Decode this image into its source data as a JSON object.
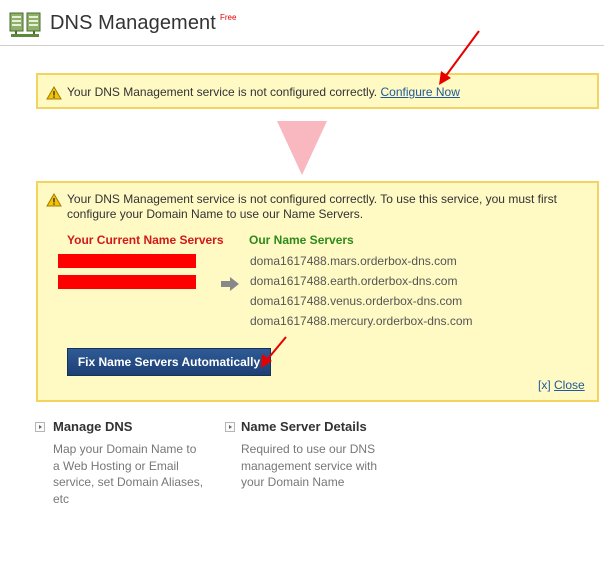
{
  "header": {
    "title": "DNS Management",
    "badge": "Free"
  },
  "alert_short": {
    "message": "Your DNS Management service is not configured correctly.",
    "link_label": "Configure Now"
  },
  "alert_full": {
    "message": "Your DNS Management service is not configured correctly. To use this service, you must first configure your Domain Name to use our Name Servers.",
    "current_heading": "Your Current Name Servers",
    "our_heading": "Our Name Servers",
    "name_servers": [
      "doma1617488.mars.orderbox-dns.com",
      "doma1617488.earth.orderbox-dns.com",
      "doma1617488.venus.orderbox-dns.com",
      "doma1617488.mercury.orderbox-dns.com"
    ],
    "fix_button": "Fix Name Servers Automatically",
    "close_prefix": "[x]",
    "close_label": "Close"
  },
  "sections": [
    {
      "title": "Manage DNS",
      "description": "Map your Domain Name to a Web Hosting or Email service, set Domain Aliases, etc"
    },
    {
      "title": "Name Server Details",
      "description": "Required to use our DNS management service with your Domain Name"
    }
  ],
  "colors": {
    "alert_bg": "#fff9c4",
    "alert_border": "#f2d45e",
    "current_heading": "#d11a1a",
    "our_heading": "#2e8b1a",
    "button": "#1d3f75",
    "link": "#1f5a9a",
    "annotation_arrow": "#e60000",
    "flow_triangle": "#f9b7bf"
  },
  "icons": [
    "dns-server-icon",
    "warning-icon",
    "gray-right-arrow-icon",
    "down-triangle-icon",
    "annotation-arrow-icon",
    "section-arrow-icon"
  ]
}
